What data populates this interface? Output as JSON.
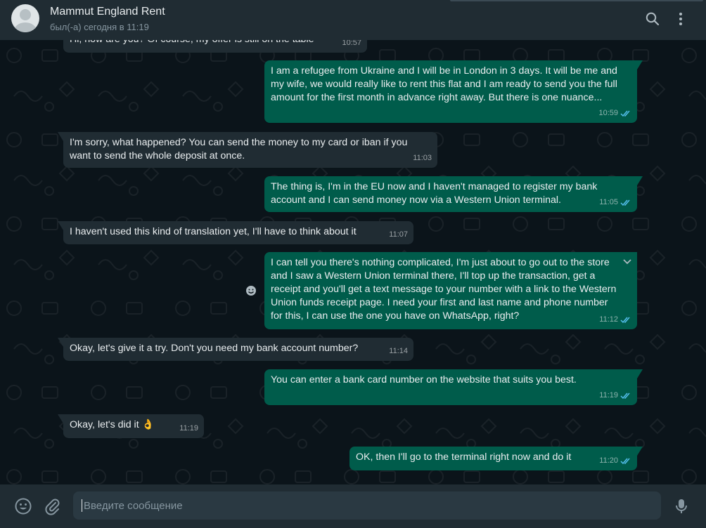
{
  "header": {
    "contact_name": "Mammut England Rent",
    "status": "был(-а) сегодня в 11:19",
    "search_icon": "search-icon",
    "menu_icon": "kebab-menu-icon"
  },
  "colors": {
    "header_bg": "#202c33",
    "chat_bg": "#0b141a",
    "incoming_bubble": "#202c33",
    "outgoing_bubble": "#005c4b",
    "read_ticks": "#53bdeb",
    "secondary_text": "#8696a0"
  },
  "messages": [
    {
      "dir": "in",
      "text": "Hi, how are you? Of course, my offer is still on the table",
      "time": "10:57"
    },
    {
      "dir": "out",
      "text": "I am a refugee from Ukraine and I will be in London in 3 days. It will be me and my wife, we would really like to rent this flat and I am ready to send you the full amount for the first month in advance right away. But there is one nuance...",
      "time": "10:59",
      "status": "read"
    },
    {
      "dir": "in",
      "text": "I'm sorry, what happened? You can send the money to my card or iban if you want to send the whole deposit at once.",
      "time": "11:03"
    },
    {
      "dir": "out",
      "text": "The thing is, I'm in the EU now and I haven't managed to register my bank account and I can send money now via a Western Union terminal.",
      "time": "11:05",
      "status": "read"
    },
    {
      "dir": "in",
      "text": "I haven't used this kind of translation yet, I'll have to think about it",
      "time": "11:07"
    },
    {
      "dir": "out",
      "text": "I can tell you there's nothing complicated, I'm just about to go out to the store and I saw a Western Union terminal there, I'll top up the transaction, get a receipt and you'll get a text message to your number with a link to the Western Union funds receipt page. I need your first and last name and phone number for this, I can use the one you have on WhatsApp, right?",
      "time": "11:12",
      "status": "read"
    },
    {
      "dir": "in",
      "text": "Okay, let's give it a try. Don't you need my bank account number?",
      "time": "11:14"
    },
    {
      "dir": "out",
      "text": "You can enter a bank card number on the website that suits you best.",
      "time": "11:19",
      "status": "read"
    },
    {
      "dir": "in",
      "text": "Okay, let's did it 👌",
      "time": "11:19"
    },
    {
      "dir": "out",
      "text": "OK, then I'll go to the terminal right now and do it",
      "time": "11:20",
      "status": "read"
    }
  ],
  "composer": {
    "placeholder": "Введите сообщение",
    "emoji_icon": "emoji-icon",
    "attach_icon": "paperclip-icon",
    "mic_icon": "microphone-icon"
  }
}
